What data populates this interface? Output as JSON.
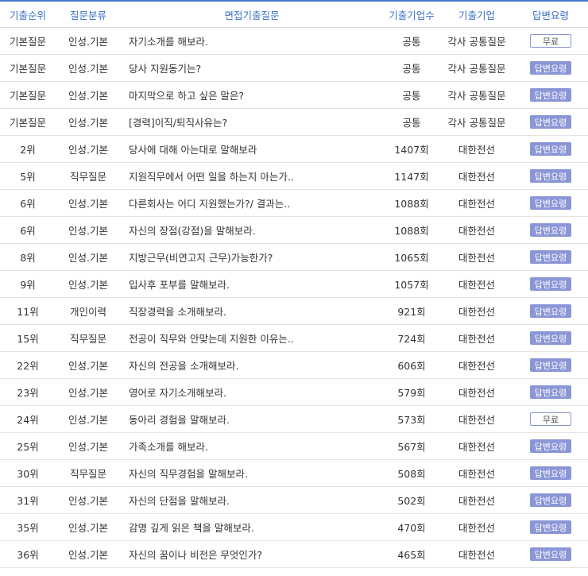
{
  "headers": {
    "rank": "기출순위",
    "category": "질문분류",
    "question": "면접기출질문",
    "count": "기출기업수",
    "company": "기출기업",
    "answer": "답변요령"
  },
  "rows": [
    {
      "rank": "기본질문",
      "category": "인성.기본",
      "question": "자기소개를 해보라.",
      "count": "공통",
      "company": "각사 공통질문",
      "answer": "무료",
      "free": true
    },
    {
      "rank": "기본질문",
      "category": "인성.기본",
      "question": "당사 지원동기는?",
      "count": "공통",
      "company": "각사 공통질문",
      "answer": "답변요령",
      "free": false
    },
    {
      "rank": "기본질문",
      "category": "인성.기본",
      "question": "마지막으로 하고 싶은 말은?",
      "count": "공통",
      "company": "각사 공통질문",
      "answer": "답변요령",
      "free": false
    },
    {
      "rank": "기본질문",
      "category": "인성.기본",
      "question": "[경력]이직/퇴직사유는?",
      "count": "공통",
      "company": "각사 공통질문",
      "answer": "답변요령",
      "free": false
    },
    {
      "rank": "2위",
      "category": "인성.기본",
      "question": "당사에 대해 아는대로 말해보라",
      "count": "1407회",
      "company": "대한전선",
      "answer": "답변요령",
      "free": false
    },
    {
      "rank": "5위",
      "category": "직무질문",
      "question": "지원직무에서 어떤 일을 하는지 아는가..",
      "count": "1147회",
      "company": "대한전선",
      "answer": "답변요령",
      "free": false
    },
    {
      "rank": "6위",
      "category": "인성.기본",
      "question": "다른회사는 어디 지원했는가?/ 결과는..",
      "count": "1088회",
      "company": "대한전선",
      "answer": "답변요령",
      "free": false
    },
    {
      "rank": "6위",
      "category": "인성.기본",
      "question": "자신의 장점(강점)을 말해보라.",
      "count": "1088회",
      "company": "대한전선",
      "answer": "답변요령",
      "free": false
    },
    {
      "rank": "8위",
      "category": "인성.기본",
      "question": "지방근무(비연고지 근무)가능한가?",
      "count": "1065회",
      "company": "대한전선",
      "answer": "답변요령",
      "free": false
    },
    {
      "rank": "9위",
      "category": "인성.기본",
      "question": "입사후 포부를 말해보라.",
      "count": "1057회",
      "company": "대한전선",
      "answer": "답변요령",
      "free": false
    },
    {
      "rank": "11위",
      "category": "개인이력",
      "question": "직장경력을 소개해보라.",
      "count": "921회",
      "company": "대한전선",
      "answer": "답변요령",
      "free": false
    },
    {
      "rank": "15위",
      "category": "직무질문",
      "question": "전공이 직무와 안맞는데 지원한 이유는..",
      "count": "724회",
      "company": "대한전선",
      "answer": "답변요령",
      "free": false
    },
    {
      "rank": "22위",
      "category": "인성.기본",
      "question": "자신의 전공을 소개해보라.",
      "count": "606회",
      "company": "대한전선",
      "answer": "답변요령",
      "free": false
    },
    {
      "rank": "23위",
      "category": "인성.기본",
      "question": "영어로 자기소개해보라.",
      "count": "579회",
      "company": "대한전선",
      "answer": "답변요령",
      "free": false
    },
    {
      "rank": "24위",
      "category": "인성.기본",
      "question": "동아리 경험을 말해보라.",
      "count": "573회",
      "company": "대한전선",
      "answer": "무료",
      "free": true
    },
    {
      "rank": "25위",
      "category": "인성.기본",
      "question": "가족소개를 해보라.",
      "count": "567회",
      "company": "대한전선",
      "answer": "답변요령",
      "free": false
    },
    {
      "rank": "30위",
      "category": "직무질문",
      "question": "자신의 직무경험을 말해보라.",
      "count": "508회",
      "company": "대한전선",
      "answer": "답변요령",
      "free": false
    },
    {
      "rank": "31위",
      "category": "인성.기본",
      "question": "자신의 단점을 말해보라.",
      "count": "502회",
      "company": "대한전선",
      "answer": "답변요령",
      "free": false
    },
    {
      "rank": "35위",
      "category": "인성.기본",
      "question": "감명 깊게 읽은 책을 말해보라.",
      "count": "470회",
      "company": "대한전선",
      "answer": "답변요령",
      "free": false
    },
    {
      "rank": "36위",
      "category": "인성.기본",
      "question": "자신의 꿈이나 비전은 무엇인가?",
      "count": "465회",
      "company": "대한전선",
      "answer": "답변요령",
      "free": false
    }
  ],
  "colors": {
    "header_text": "#3a70c8",
    "header_border": "#3f78d0",
    "badge_paid": "#8a96d6",
    "badge_free_border": "#8a96d6"
  }
}
